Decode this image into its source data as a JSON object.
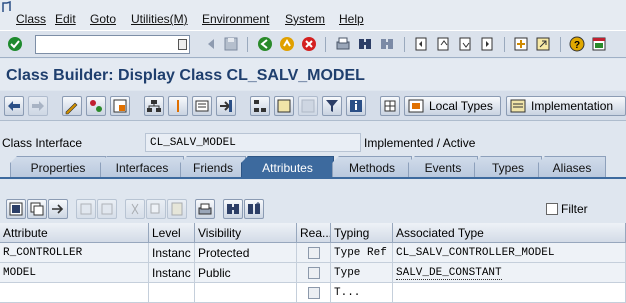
{
  "menu": {
    "items": [
      "Class",
      "Edit",
      "Goto",
      "Utilities(M)",
      "Environment",
      "System",
      "Help"
    ]
  },
  "toolbar": {
    "command_value": ""
  },
  "title": "Class Builder: Display Class CL_SALV_MODEL",
  "app_toolbar": {
    "local_types_label": "Local Types",
    "implementation_label": "Implementation"
  },
  "class_interface": {
    "label": "Class Interface",
    "value": "CL_SALV_MODEL",
    "status": "Implemented / Active"
  },
  "tabs": [
    "Properties",
    "Interfaces",
    "Friends",
    "Attributes",
    "Methods",
    "Events",
    "Types",
    "Aliases"
  ],
  "active_tab": "Attributes",
  "filter_label": "Filter",
  "grid": {
    "columns": [
      "Attribute",
      "Level",
      "Visibility",
      "Rea...",
      "Typing",
      "Associated Type"
    ],
    "rows": [
      {
        "attribute": "R_CONTROLLER",
        "level": "Instanc",
        "visibility": "Protected",
        "typing": "Type Ref",
        "type": "CL_SALV_CONTROLLER_MODEL"
      },
      {
        "attribute": "MODEL",
        "level": "Instanc",
        "visibility": "Public",
        "typing": "Type",
        "type": "SALV_DE_CONSTANT"
      },
      {
        "attribute": "",
        "level": "",
        "visibility": "",
        "typing": "T...",
        "type": ""
      }
    ]
  },
  "colors": {
    "title": "#1f3f6e",
    "active_tab": "#3d6a9e"
  }
}
